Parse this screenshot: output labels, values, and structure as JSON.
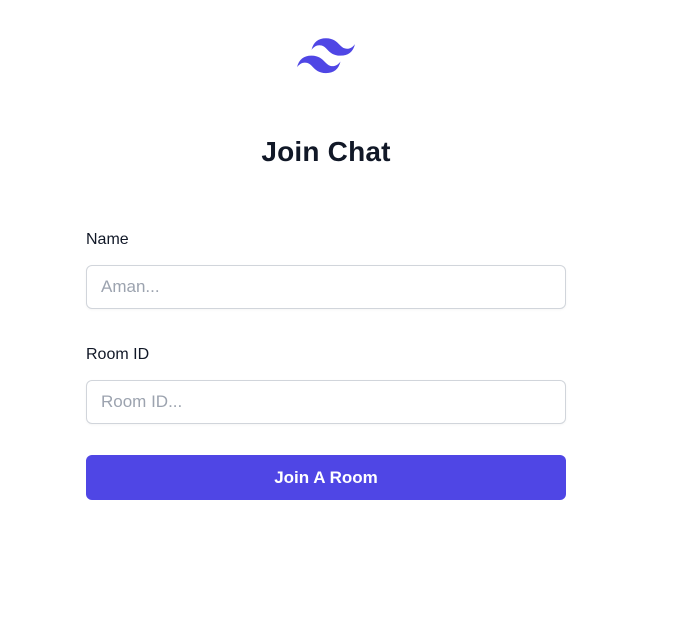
{
  "app": {
    "logo_icon": "tailwind-wave-logo",
    "brand_color": "#4f46e5",
    "title": "Join Chat"
  },
  "form": {
    "name_label": "Name",
    "name_placeholder": "Aman...",
    "name_value": "",
    "room_label": "Room ID",
    "room_placeholder": "Room ID...",
    "room_value": "",
    "submit_label": "Join A Room"
  }
}
